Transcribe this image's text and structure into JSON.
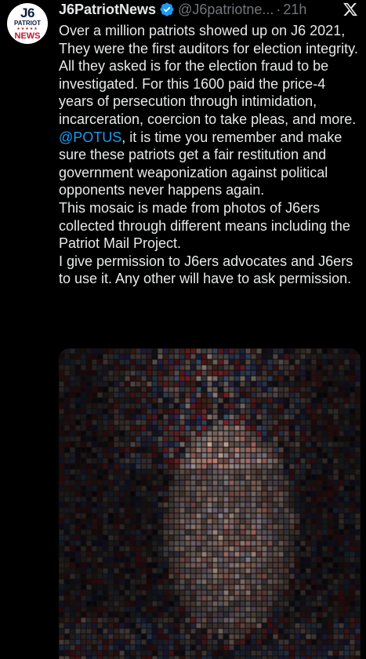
{
  "tweet": {
    "avatar": {
      "line1": "J6",
      "line2": "PATRIOT",
      "stars": "★★★★★",
      "line3": "NEWS"
    },
    "display_name": "J6PatriotNews",
    "handle": "@J6patriotne...",
    "separator": "·",
    "time": "21h",
    "paragraphs": [
      "Over a million patriots showed up on J6 2021, They were the first auditors for election integrity. All they asked is for the election fraud to be investigated. For this 1600 paid the price-4 years of persecution through intimidation, incarceration, coercion to take pleas, and more.",
      "This mosaic is made from photos of J6ers collected through different means including the Patriot Mail Project.",
      "I give permission to J6ers advocates and J6ers to use it. Any other will have to ask permission."
    ],
    "mention": "@POTUS",
    "mention_text": ", it is time you remember and make sure these patriots get a fair restitution and government weaponization against political opponents never happens again.",
    "media_description": ""
  },
  "colors": {
    "background": "#000000",
    "text": "#e7e9ea",
    "muted": "#71767b",
    "link": "#1d9bf0",
    "verified": "#1d9bf0"
  },
  "icons": {
    "verified": "verified-badge-icon",
    "platform": "x-logo-icon"
  }
}
